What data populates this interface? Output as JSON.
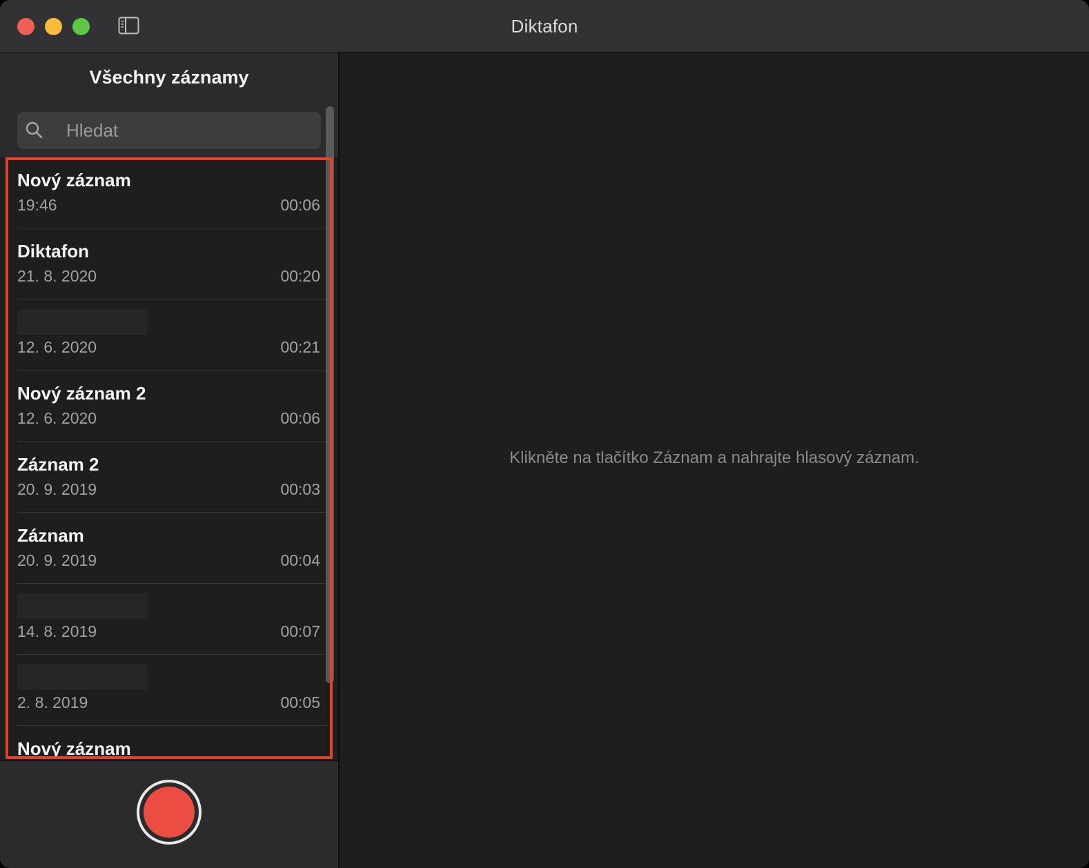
{
  "window": {
    "title": "Diktafon"
  },
  "sidebar": {
    "title": "Všechny záznamy",
    "search_placeholder": "Hledat",
    "recordings": [
      {
        "title": "Nový záznam",
        "date": "19:46",
        "duration": "00:06"
      },
      {
        "title": "Diktafon",
        "date": "21. 8. 2020",
        "duration": "00:20"
      },
      {
        "title": "",
        "date": "12. 6. 2020",
        "duration": "00:21"
      },
      {
        "title": "Nový záznam 2",
        "date": "12. 6. 2020",
        "duration": "00:06"
      },
      {
        "title": "Záznam 2",
        "date": "20. 9. 2019",
        "duration": "00:03"
      },
      {
        "title": "Záznam",
        "date": "20. 9. 2019",
        "duration": "00:04"
      },
      {
        "title": "",
        "date": "14. 8. 2019",
        "duration": "00:07"
      },
      {
        "title": "",
        "date": "2. 8. 2019",
        "duration": "00:05"
      },
      {
        "title": "Nový záznam",
        "date": "",
        "duration": ""
      }
    ]
  },
  "detail": {
    "empty_message": "Klikněte na tlačítko Záznam a nahrajte hlasový záznam."
  },
  "icons": {
    "sidebar_toggle": "sidebar-toggle-icon",
    "search": "magnifier-icon",
    "record": "record-icon"
  },
  "colors": {
    "close": "#ee5f57",
    "minimize": "#f6bd3b",
    "maximize": "#5dc644",
    "record": "#ec4d42",
    "highlight": "#e2412d"
  }
}
